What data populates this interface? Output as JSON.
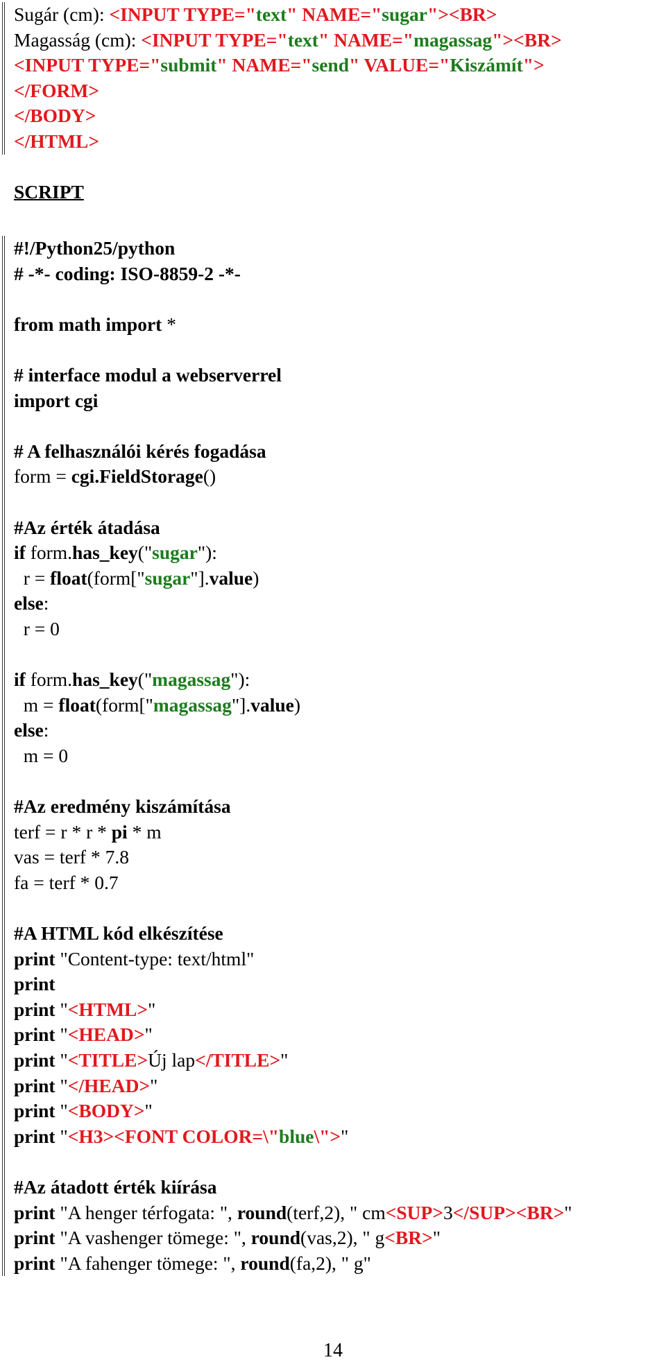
{
  "colors": {
    "tag": "#e1191e",
    "string": "#1c7c1c",
    "text": "#000000"
  },
  "html_block": {
    "lines": [
      {
        "segments": [
          {
            "text": "Sugár (cm): ",
            "style": "n"
          },
          {
            "text": "<INPUT TYPE=\"",
            "style": "t"
          },
          {
            "text": "text",
            "style": "s"
          },
          {
            "text": "\" NAME=\"",
            "style": "t"
          },
          {
            "text": "sugar",
            "style": "s"
          },
          {
            "text": "\"><BR>",
            "style": "t"
          }
        ]
      },
      {
        "segments": [
          {
            "text": "Magasság (cm): ",
            "style": "n"
          },
          {
            "text": "<INPUT TYPE=\"",
            "style": "t"
          },
          {
            "text": "text",
            "style": "s"
          },
          {
            "text": "\" NAME=\"",
            "style": "t"
          },
          {
            "text": "magassag",
            "style": "s"
          },
          {
            "text": "\"><BR>",
            "style": "t"
          }
        ]
      },
      {
        "segments": [
          {
            "text": "<INPUT TYPE=\"",
            "style": "t"
          },
          {
            "text": "submit",
            "style": "s"
          },
          {
            "text": "\" NAME=\"",
            "style": "t"
          },
          {
            "text": "send",
            "style": "s"
          },
          {
            "text": "\" VALUE=\"",
            "style": "t"
          },
          {
            "text": "Kiszámít",
            "style": "s"
          },
          {
            "text": "\">",
            "style": "t"
          }
        ]
      },
      {
        "segments": [
          {
            "text": "</FORM>",
            "style": "t"
          }
        ]
      },
      {
        "segments": [
          {
            "text": "</BODY>",
            "style": "t"
          }
        ]
      },
      {
        "segments": [
          {
            "text": "</HTML>",
            "style": "t"
          }
        ]
      }
    ]
  },
  "section_title": "SCRIPT",
  "script_block": {
    "lines": [
      {
        "segments": [
          {
            "text": "#!/Python25/python",
            "style": "b"
          }
        ]
      },
      {
        "segments": [
          {
            "text": "# -*- coding: ISO-8859-2 -*-",
            "style": "b"
          }
        ]
      },
      {
        "segments": []
      },
      {
        "segments": [
          {
            "text": "from math import ",
            "style": "b"
          },
          {
            "text": "*",
            "style": "n"
          }
        ]
      },
      {
        "segments": []
      },
      {
        "segments": [
          {
            "text": "# interface modul a webserverrel",
            "style": "b"
          }
        ]
      },
      {
        "segments": [
          {
            "text": "import cgi",
            "style": "b"
          }
        ]
      },
      {
        "segments": []
      },
      {
        "segments": [
          {
            "text": "# A felhasználói kérés fogadása",
            "style": "b"
          }
        ]
      },
      {
        "segments": [
          {
            "text": "form = ",
            "style": "n"
          },
          {
            "text": "cgi.FieldStorage",
            "style": "b"
          },
          {
            "text": "()",
            "style": "n"
          }
        ]
      },
      {
        "segments": []
      },
      {
        "segments": [
          {
            "text": "#Az érték átadása",
            "style": "b"
          }
        ]
      },
      {
        "segments": [
          {
            "text": "if",
            "style": "b"
          },
          {
            "text": " form.",
            "style": "n"
          },
          {
            "text": "has_key",
            "style": "b"
          },
          {
            "text": "(\"",
            "style": "n"
          },
          {
            "text": "sugar",
            "style": "s"
          },
          {
            "text": "\"):",
            "style": "n"
          }
        ]
      },
      {
        "segments": [
          {
            "text": "  r = ",
            "style": "n"
          },
          {
            "text": "float",
            "style": "b"
          },
          {
            "text": "(form[\"",
            "style": "n"
          },
          {
            "text": "sugar",
            "style": "s"
          },
          {
            "text": "\"].",
            "style": "n"
          },
          {
            "text": "value",
            "style": "b"
          },
          {
            "text": ")",
            "style": "n"
          }
        ]
      },
      {
        "segments": [
          {
            "text": "else",
            "style": "b"
          },
          {
            "text": ":",
            "style": "n"
          }
        ]
      },
      {
        "segments": [
          {
            "text": "  r = 0",
            "style": "n"
          }
        ]
      },
      {
        "segments": []
      },
      {
        "segments": [
          {
            "text": "if",
            "style": "b"
          },
          {
            "text": " form.",
            "style": "n"
          },
          {
            "text": "has_key",
            "style": "b"
          },
          {
            "text": "(\"",
            "style": "n"
          },
          {
            "text": "magassag",
            "style": "s"
          },
          {
            "text": "\"):",
            "style": "n"
          }
        ]
      },
      {
        "segments": [
          {
            "text": "  m = ",
            "style": "n"
          },
          {
            "text": "float",
            "style": "b"
          },
          {
            "text": "(form[\"",
            "style": "n"
          },
          {
            "text": "magassag",
            "style": "s"
          },
          {
            "text": "\"].",
            "style": "n"
          },
          {
            "text": "value",
            "style": "b"
          },
          {
            "text": ")",
            "style": "n"
          }
        ]
      },
      {
        "segments": [
          {
            "text": "else",
            "style": "b"
          },
          {
            "text": ":",
            "style": "n"
          }
        ]
      },
      {
        "segments": [
          {
            "text": "  m = 0",
            "style": "n"
          }
        ]
      },
      {
        "segments": []
      },
      {
        "segments": [
          {
            "text": "#Az eredmény kiszámítása",
            "style": "b"
          }
        ]
      },
      {
        "segments": [
          {
            "text": "terf = r * r * ",
            "style": "n"
          },
          {
            "text": "pi",
            "style": "b"
          },
          {
            "text": " * m",
            "style": "n"
          }
        ]
      },
      {
        "segments": [
          {
            "text": "vas = terf * 7.8",
            "style": "n"
          }
        ]
      },
      {
        "segments": [
          {
            "text": "fa = terf * 0.7",
            "style": "n"
          }
        ]
      },
      {
        "segments": []
      },
      {
        "segments": [
          {
            "text": "#A HTML kód elkészítése",
            "style": "b"
          }
        ]
      },
      {
        "segments": [
          {
            "text": "print",
            "style": "b"
          },
          {
            "text": " \"Content-type: text/html\"",
            "style": "n"
          }
        ]
      },
      {
        "segments": [
          {
            "text": "print",
            "style": "b"
          }
        ]
      },
      {
        "segments": [
          {
            "text": "print",
            "style": "b"
          },
          {
            "text": " \"",
            "style": "n"
          },
          {
            "text": "<HTML>",
            "style": "t"
          },
          {
            "text": "\"",
            "style": "n"
          }
        ]
      },
      {
        "segments": [
          {
            "text": "print",
            "style": "b"
          },
          {
            "text": " \"",
            "style": "n"
          },
          {
            "text": "<HEAD>",
            "style": "t"
          },
          {
            "text": "\"",
            "style": "n"
          }
        ]
      },
      {
        "segments": [
          {
            "text": "print",
            "style": "b"
          },
          {
            "text": " \"",
            "style": "n"
          },
          {
            "text": "<TITLE>",
            "style": "t"
          },
          {
            "text": "Új lap",
            "style": "n"
          },
          {
            "text": "</TITLE>",
            "style": "t"
          },
          {
            "text": "\"",
            "style": "n"
          }
        ]
      },
      {
        "segments": [
          {
            "text": "print",
            "style": "b"
          },
          {
            "text": " \"",
            "style": "n"
          },
          {
            "text": "</HEAD>",
            "style": "t"
          },
          {
            "text": "\"",
            "style": "n"
          }
        ]
      },
      {
        "segments": [
          {
            "text": "print",
            "style": "b"
          },
          {
            "text": " \"",
            "style": "n"
          },
          {
            "text": "<BODY>",
            "style": "t"
          },
          {
            "text": "\"",
            "style": "n"
          }
        ]
      },
      {
        "segments": [
          {
            "text": "print",
            "style": "b"
          },
          {
            "text": " \"",
            "style": "n"
          },
          {
            "text": "<H3><FONT COLOR=\\\"",
            "style": "t"
          },
          {
            "text": "blue",
            "style": "s"
          },
          {
            "text": "\\\">",
            "style": "t"
          },
          {
            "text": "\"",
            "style": "n"
          }
        ]
      },
      {
        "segments": []
      },
      {
        "segments": [
          {
            "text": "#Az átadott érték kiírása",
            "style": "b"
          }
        ]
      },
      {
        "segments": [
          {
            "text": "print",
            "style": "b"
          },
          {
            "text": " \"A henger térfogata: \", ",
            "style": "n"
          },
          {
            "text": "round",
            "style": "b"
          },
          {
            "text": "(terf,2), \" cm",
            "style": "n"
          },
          {
            "text": "<SUP>",
            "style": "t"
          },
          {
            "text": "3",
            "style": "n"
          },
          {
            "text": "</SUP><BR>",
            "style": "t"
          },
          {
            "text": "\"",
            "style": "n"
          }
        ]
      },
      {
        "segments": [
          {
            "text": "print",
            "style": "b"
          },
          {
            "text": " \"A vashenger tömege: \", ",
            "style": "n"
          },
          {
            "text": "round",
            "style": "b"
          },
          {
            "text": "(vas,2), \" g",
            "style": "n"
          },
          {
            "text": "<BR>",
            "style": "t"
          },
          {
            "text": "\"",
            "style": "n"
          }
        ]
      },
      {
        "segments": [
          {
            "text": "print",
            "style": "b"
          },
          {
            "text": " \"A fahenger tömege: \", ",
            "style": "n"
          },
          {
            "text": "round",
            "style": "b"
          },
          {
            "text": "(fa,2), \" g\"",
            "style": "n"
          }
        ]
      }
    ]
  },
  "page_number": "14"
}
